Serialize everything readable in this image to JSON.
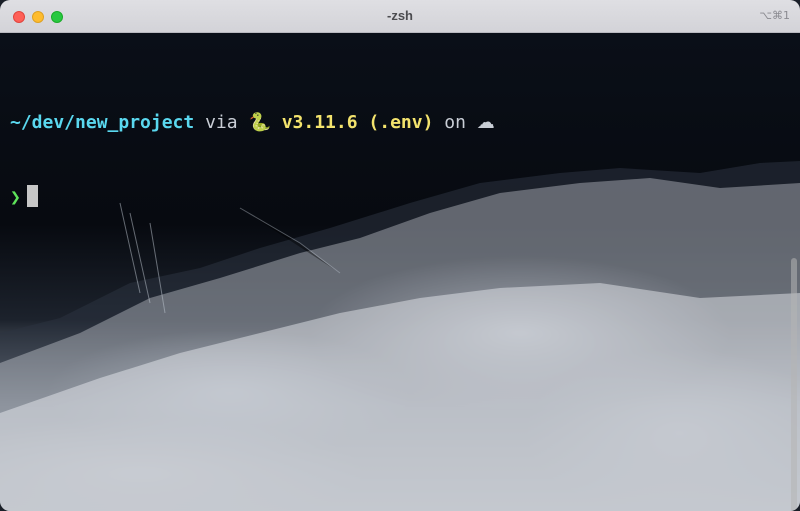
{
  "window": {
    "title": "-zsh",
    "shortcut": "⌥⌘1"
  },
  "prompt": {
    "path": "~/dev/new_project",
    "via": "via",
    "python_icon": "snake-icon",
    "python_icon_glyph": "🐍",
    "python_version": "v3.11.6 (.env)",
    "on": "on",
    "cloud_icon": "cloud-icon",
    "cloud_icon_glyph": "☁",
    "input_symbol": "❯"
  },
  "colors": {
    "path": "#5ad8ef",
    "python": "#f3e36d",
    "prompt_symbol": "#5ee35a",
    "cursor": "#c7c7c7"
  }
}
